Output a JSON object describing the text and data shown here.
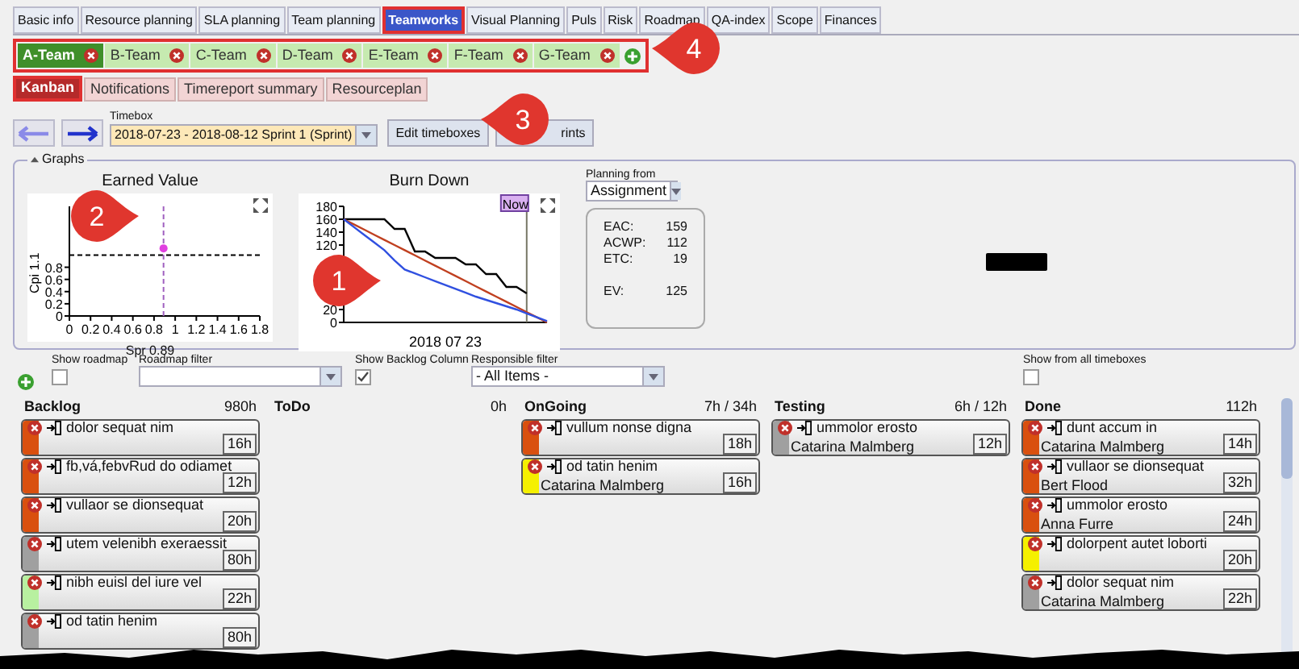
{
  "main_tabs": [
    {
      "label": "Basic info",
      "selected": false
    },
    {
      "label": "Resource planning",
      "selected": false
    },
    {
      "label": "SLA planning",
      "selected": false
    },
    {
      "label": "Team planning",
      "selected": false
    },
    {
      "label": "Teamworks",
      "selected": true
    },
    {
      "label": "Visual Planning",
      "selected": false
    },
    {
      "label": "Puls",
      "selected": false
    },
    {
      "label": "Risk",
      "selected": false
    },
    {
      "label": "Roadmap",
      "selected": false
    },
    {
      "label": "QA-index",
      "selected": false
    },
    {
      "label": "Scope",
      "selected": false
    },
    {
      "label": "Finances",
      "selected": false
    }
  ],
  "team_tabs": [
    {
      "label": "A-Team",
      "selected": true
    },
    {
      "label": "B-Team",
      "selected": false
    },
    {
      "label": "C-Team",
      "selected": false
    },
    {
      "label": "D-Team",
      "selected": false
    },
    {
      "label": "E-Team",
      "selected": false
    },
    {
      "label": "F-Team",
      "selected": false
    },
    {
      "label": "G-Team",
      "selected": false
    }
  ],
  "sub_tabs": [
    {
      "label": "Kanban",
      "selected": true
    },
    {
      "label": "Notifications",
      "selected": false
    },
    {
      "label": "Timereport summary",
      "selected": false
    },
    {
      "label": "Resourceplan",
      "selected": false
    }
  ],
  "toolbar": {
    "timebox_label": "Timebox",
    "timebox_value": "2018-07-23 - 2018-08-12 Sprint 1 (Sprint)",
    "buttons": [
      "Edit timeboxes",
      "rints"
    ]
  },
  "graphs": {
    "legend": "Graphs",
    "earned_value": {
      "title": "Earned Value",
      "chart_data": {
        "type": "scatter",
        "xlabel": "Spr 0.89",
        "ylabel": "Cpi 1.1",
        "xlim": [
          0,
          1.8
        ],
        "ylim": [
          0,
          1.8
        ],
        "xticks": [
          0,
          0.2,
          0.4,
          0.6,
          0.8,
          1,
          1.2,
          1.4,
          1.6,
          1.8
        ],
        "yticks": [
          0,
          0.2,
          0.4,
          0.6,
          0.8
        ],
        "x": [
          0.89
        ],
        "series": [
          {
            "color": "#e040e0",
            "values": [
              1.11
            ]
          }
        ],
        "ref_lines": [
          {
            "axis": "y",
            "value": 1
          },
          {
            "axis": "x",
            "value": 0.89
          }
        ]
      }
    },
    "burn_down": {
      "title": "Burn Down",
      "now_label": "Now",
      "chart_data": {
        "type": "line",
        "xlabel": "2018 07 23",
        "ylim": [
          0,
          180
        ],
        "yticks": [
          0,
          20,
          120,
          140,
          160,
          180
        ],
        "series": [
          {
            "color": "#000000",
            "values": [
              160,
              160,
              160,
              160,
              160,
              145,
              145,
              110,
              110,
              100,
              100,
              100,
              90,
              90,
              75,
              75,
              55,
              55,
              45,
              null,
              null
            ]
          },
          {
            "color": "#c04020",
            "values": [
              160,
              152,
              144,
              136,
              128,
              120,
              112,
              104,
              96,
              88,
              80,
              72,
              64,
              56,
              48,
              40,
              32,
              24,
              16,
              8,
              0
            ]
          },
          {
            "color": "#3050e0",
            "values": [
              160,
              148,
              136,
              124,
              112,
              96,
              82,
              76,
              70,
              64,
              58,
              52,
              46,
              40,
              35,
              30,
              25,
              20,
              14,
              8,
              2
            ]
          }
        ]
      }
    },
    "planning_from": {
      "label": "Planning from",
      "value": "Assignment"
    },
    "stat_groups": [
      [
        {
          "label": "EAC:",
          "value": "159"
        },
        {
          "label": "ACWP:",
          "value": "112"
        },
        {
          "label": "ETC:",
          "value": "19"
        }
      ],
      [
        {
          "label": "EV:",
          "value": "125"
        }
      ]
    ]
  },
  "filters": {
    "show_roadmap": {
      "label": "Show roadmap",
      "checked": false
    },
    "roadmap_filter": {
      "label": "Roadmap filter"
    },
    "show_backlog": {
      "label": "Show Backlog Column",
      "checked": true
    },
    "responsible_filter": {
      "label": "Responsible filter",
      "value": "- All Items -"
    },
    "show_all_timeboxes": {
      "label": "Show from all timeboxes",
      "checked": false
    }
  },
  "columns": [
    {
      "title": "Backlog",
      "hours": "980h",
      "cards": [
        {
          "title": "dolor sequat nim",
          "hours": "16h",
          "color": "#d9500f"
        },
        {
          "title": "fb,vá,febvRud do odiamet",
          "hours": "12h",
          "color": "#d9500f"
        },
        {
          "title": "vullaor se dionsequat",
          "hours": "20h",
          "color": "#d9500f"
        },
        {
          "title": "utem velenibh exeraessit",
          "hours": "80h",
          "color": "#a0a0a0"
        },
        {
          "title": "nibh euisl del iure vel",
          "hours": "22h",
          "color": "#b8f0a0"
        },
        {
          "title": "od tatin henim",
          "hours": "80h",
          "color": "#a0a0a0"
        }
      ]
    },
    {
      "title": "ToDo",
      "hours": "0h"
    },
    {
      "title": "OnGoing",
      "hours": "7h / 34h",
      "cards": [
        {
          "title": "vullum nonse digna",
          "hours": "18h",
          "color": "#d9500f"
        },
        {
          "title": "od tatin henim",
          "person": "Catarina Malmberg",
          "hours": "16h",
          "color": "#f5f000"
        }
      ]
    },
    {
      "title": "Testing",
      "hours": "6h / 12h",
      "cards": [
        {
          "title": "ummolor erosto",
          "person": "Catarina Malmberg",
          "hours": "12h",
          "color": "#a0a0a0"
        }
      ]
    },
    {
      "title": "Done",
      "hours": "112h",
      "cards": [
        {
          "title": "dunt accum in",
          "person": "Catarina Malmberg",
          "hours": "14h",
          "color": "#d9500f"
        },
        {
          "title": "vullaor se dionsequat",
          "person": "Bert Flood",
          "hours": "32h",
          "color": "#d9500f"
        },
        {
          "title": "ummolor erosto",
          "person": "Anna Furre",
          "hours": "24h",
          "color": "#d9500f"
        },
        {
          "title": "dolorpent autet loborti",
          "hours": "20h",
          "color": "#f5f000"
        },
        {
          "title": "dolor sequat nim",
          "person": "Catarina Malmberg",
          "hours": "22h",
          "color": "#a0a0a0"
        }
      ]
    }
  ],
  "callouts": [
    "1",
    "2",
    "3",
    "4"
  ]
}
